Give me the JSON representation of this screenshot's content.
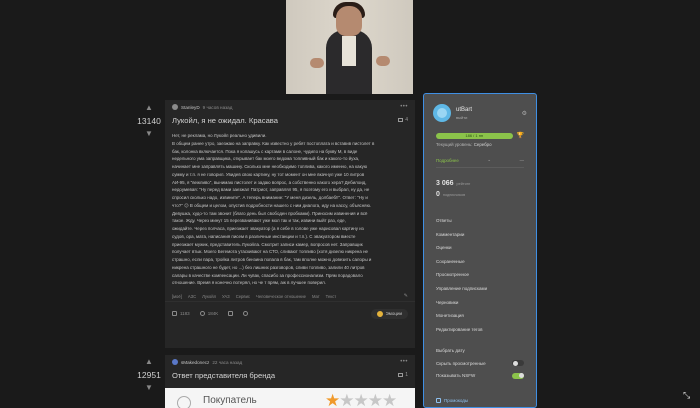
{
  "post1": {
    "rating": "13140",
    "author": "StanleyD",
    "time": "9 часов назад",
    "title": "Лукойл, я не ожидал. Красава",
    "comments_count": "4",
    "body": [
      "Нет, не реклама, но Лукойл реально удивили.",
      "В общем ранее утро, заезжаю на заправку. Как известно у ребят постоплата и вставив пистолет в",
      "бак, колонка включается. Пока я копашусь с картами в салоне, чудило на букву М, в виде",
      "недельного ума заправщика, открывает бак моего ведома топливный бак и какого-то йуха,",
      "начинает мне заправлять машину. Сколько мне необходимо топлива, какого именно, на какую",
      "сумму и т.п. я не говорил. Увидев свою картину, ну тот момент он мне вкачнул уже 10 литров",
      "АИ-95, я \"вежливо\", вынимаю пистолет и задаю вопрос, а собственно какого хера? Дебилоид,",
      "недоумевая: \"Ну перед вами заезжал Патриот, заправлял 95, я поэтому его и выбрал, ну да, не",
      "спросил сколько надо, извините\". А теперь внимание: \"У меня дизель, долбаеб!!\". Ответ: \"Ну и",
      "что?\" 😕 В общем и целом, опустив подробности нашего с ним диалога, иду на кассу, объясняю.",
      "Девушка, худо-то там звонит (благо день был свободен пробками). Приносим извинения и всё",
      "такое. Жду. Через минут 15 перезванивают уже мол так и так, извини выйт раз, еде,",
      "ожидайте. Через полчаса, приезжает эвакуатор (а я себе в голове уже нарисовал картину из",
      "судов, ора, мата, написания писем в различные инстанции и т.п.). С эвакуатором вместе",
      "приезжает мужик, представитель Лукойла. Смотрит записи камер, вопросов нет. Заправщик",
      "получает втык. Моего Бегемота утаскивают на СТО, сливают топливо (хотя дизелю никрена не",
      "страшно, если пара, тройка литров бензина попала в бак, там вполне можно довезить салоры и",
      "никрена страшного не будет, но ...) без лишних разговоров, сливи топливо, залили 40 литров",
      "салары в качестве компенсации. Ли чувак, спасибо за профессионализм. Прям порадовало",
      "отношение. Время я конечно потерял, но че т прям, аж в лучшее поверил."
    ],
    "tags": [
      "[моё]",
      "АЗС",
      "Лукойл",
      "УАЗ",
      "Сервис",
      "Человеческое отношение",
      "Мат",
      "Текст"
    ],
    "footer": {
      "comments": "1183",
      "views": "184K",
      "emoji_label": "Эмоции"
    }
  },
  "post2": {
    "rating": "12951",
    "author": "sMakedonecz",
    "time": "22 часа назад",
    "title": "Ответ представителя бренда",
    "comments_count": "1",
    "image_text": "Покупатель"
  },
  "profile": {
    "name": "utBart",
    "logout": "выйти",
    "progress_text": "186 / 1 нн",
    "level_label": "Текущий уровень:",
    "level_value": "Серебро",
    "subscribed": "Подробнее",
    "stats": [
      {
        "num": "3 066",
        "label": "рейтинг"
      },
      {
        "num": "0",
        "label": "подписчиков"
      }
    ],
    "menu": [
      "Ответы",
      "Комментарии",
      "Оценки",
      "Сохраненные",
      "Просмотренное",
      "Управление подписками",
      "Черновики",
      "Монетизация",
      "Редактирование тегов"
    ],
    "settings": [
      {
        "label": "Выбрать дату",
        "toggle": null
      },
      {
        "label": "Скрыть просмотренные",
        "toggle": false
      },
      {
        "label": "Показывать NSFW",
        "toggle": true
      }
    ],
    "bottom_link": "Промокоды"
  },
  "colors": {
    "accent": "#3f8fe3",
    "progress": "#8bc34a",
    "star": "#f09a2c"
  }
}
